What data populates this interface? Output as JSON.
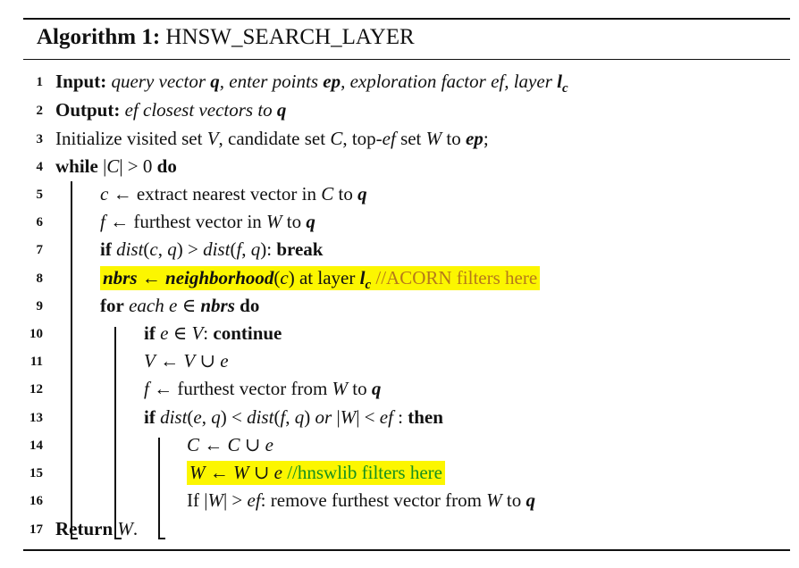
{
  "algorithm": {
    "label": "Algorithm 1:",
    "name": "HNSW_SEARCH_LAYER"
  },
  "lines": [
    {
      "n": "1",
      "parts": [
        [
          "kw",
          "Input:"
        ],
        [
          "t",
          " "
        ],
        [
          "it",
          "query vector "
        ],
        [
          "bi",
          "q"
        ],
        [
          "it",
          ", enter points "
        ],
        [
          "bi",
          "ep"
        ],
        [
          "it",
          ", exploration factor "
        ],
        [
          "it",
          "ef"
        ],
        [
          "it",
          ", layer "
        ],
        [
          "bi",
          "l"
        ],
        [
          "sub",
          "c"
        ]
      ]
    },
    {
      "n": "2",
      "parts": [
        [
          "kw",
          "Output:"
        ],
        [
          "t",
          " "
        ],
        [
          "it",
          "ef"
        ],
        [
          "it",
          "  closest vectors to "
        ],
        [
          "bi",
          "q"
        ]
      ]
    },
    {
      "n": "3",
      "parts": [
        [
          "t",
          "Initialize visited set "
        ],
        [
          "it",
          "V"
        ],
        [
          "t",
          ", candidate set "
        ],
        [
          "it",
          "C"
        ],
        [
          "t",
          ", top-"
        ],
        [
          "it",
          "ef"
        ],
        [
          "t",
          " set "
        ],
        [
          "it",
          "W"
        ],
        [
          "t",
          " to "
        ],
        [
          "bi",
          "ep"
        ],
        [
          "t",
          ";"
        ]
      ]
    },
    {
      "n": "4",
      "parts": [
        [
          "kw",
          "while"
        ],
        [
          "t",
          " |"
        ],
        [
          "it",
          "C"
        ],
        [
          "t",
          "| > 0 "
        ],
        [
          "kw",
          "do"
        ]
      ]
    },
    {
      "n": "5",
      "parts": [
        [
          "it",
          "c"
        ],
        [
          "t",
          " ← extract nearest vector in "
        ],
        [
          "it",
          "C"
        ],
        [
          "t",
          " to "
        ],
        [
          "bi",
          "q"
        ]
      ]
    },
    {
      "n": "6",
      "parts": [
        [
          "it",
          "f"
        ],
        [
          "t",
          " ← furthest vector in "
        ],
        [
          "it",
          "W"
        ],
        [
          "t",
          " to "
        ],
        [
          "bi",
          "q"
        ]
      ]
    },
    {
      "n": "7",
      "parts": [
        [
          "kw",
          "if"
        ],
        [
          "t",
          " "
        ],
        [
          "it",
          "dist"
        ],
        [
          "t",
          "("
        ],
        [
          "it",
          "c"
        ],
        [
          "t",
          ", "
        ],
        [
          "it",
          "q"
        ],
        [
          "t",
          ") > "
        ],
        [
          "it",
          "dist"
        ],
        [
          "t",
          "("
        ],
        [
          "it",
          "f"
        ],
        [
          "t",
          ", "
        ],
        [
          "it",
          "q"
        ],
        [
          "t",
          "): "
        ],
        [
          "kw",
          "break"
        ]
      ]
    },
    {
      "n": "8",
      "hl": "orange",
      "parts": [
        [
          "bi",
          "nbrs"
        ],
        [
          "t",
          " ← "
        ],
        [
          "bi",
          "neighborhood"
        ],
        [
          "t",
          "("
        ],
        [
          "it",
          "c"
        ],
        [
          "t",
          ") at layer "
        ],
        [
          "bi",
          "l"
        ],
        [
          "sub",
          "c"
        ],
        [
          "t",
          " "
        ],
        [
          "cmo",
          "//ACORN filters here"
        ]
      ]
    },
    {
      "n": "9",
      "parts": [
        [
          "kw",
          "for"
        ],
        [
          "t",
          " "
        ],
        [
          "it",
          "each "
        ],
        [
          "it",
          "e"
        ],
        [
          "t",
          " ∈ "
        ],
        [
          "bi",
          "nbrs"
        ],
        [
          "t",
          " "
        ],
        [
          "kw",
          "do"
        ]
      ]
    },
    {
      "n": "10",
      "parts": [
        [
          "kw",
          "if"
        ],
        [
          "t",
          " "
        ],
        [
          "it",
          "e"
        ],
        [
          "t",
          " ∈ "
        ],
        [
          "it",
          "V"
        ],
        [
          "t",
          ": "
        ],
        [
          "kw",
          "continue"
        ]
      ]
    },
    {
      "n": "11",
      "parts": [
        [
          "it",
          "V"
        ],
        [
          "t",
          " ← "
        ],
        [
          "it",
          "V"
        ],
        [
          "t",
          " ∪ "
        ],
        [
          "it",
          "e"
        ]
      ]
    },
    {
      "n": "12",
      "parts": [
        [
          "it",
          "f"
        ],
        [
          "t",
          " ← furthest vector from "
        ],
        [
          "it",
          "W"
        ],
        [
          "t",
          " to "
        ],
        [
          "bi",
          "q"
        ]
      ]
    },
    {
      "n": "13",
      "parts": [
        [
          "kw",
          "if"
        ],
        [
          "t",
          " "
        ],
        [
          "it",
          "dist"
        ],
        [
          "t",
          "("
        ],
        [
          "it",
          "e"
        ],
        [
          "t",
          ", "
        ],
        [
          "it",
          "q"
        ],
        [
          "t",
          ") < "
        ],
        [
          "it",
          "dist"
        ],
        [
          "t",
          "("
        ],
        [
          "it",
          "f"
        ],
        [
          "t",
          ", "
        ],
        [
          "it",
          "q"
        ],
        [
          "t",
          ") "
        ],
        [
          "it",
          "or"
        ],
        [
          "t",
          " |"
        ],
        [
          "it",
          "W"
        ],
        [
          "t",
          "| < "
        ],
        [
          "it",
          "ef"
        ],
        [
          "t",
          " : "
        ],
        [
          "kw",
          "then"
        ]
      ]
    },
    {
      "n": "14",
      "parts": [
        [
          "it",
          "C"
        ],
        [
          "t",
          " ← "
        ],
        [
          "it",
          "C"
        ],
        [
          "t",
          " ∪ "
        ],
        [
          "it",
          "e"
        ]
      ]
    },
    {
      "n": "15",
      "hl": "green",
      "parts": [
        [
          "it",
          "W"
        ],
        [
          "t",
          " ← "
        ],
        [
          "it",
          "W"
        ],
        [
          "t",
          " ∪ "
        ],
        [
          "it",
          "e"
        ],
        [
          "t",
          " "
        ],
        [
          "cmg",
          "//hnswlib filters here"
        ]
      ]
    },
    {
      "n": "16",
      "parts": [
        [
          "t",
          "If |"
        ],
        [
          "it",
          "W"
        ],
        [
          "t",
          "| > "
        ],
        [
          "it",
          "ef"
        ],
        [
          "t",
          ": remove furthest vector from "
        ],
        [
          "it",
          "W"
        ],
        [
          "t",
          " to "
        ],
        [
          "bi",
          "q"
        ]
      ]
    },
    {
      "n": "17",
      "parts": [
        [
          "kw",
          "Return"
        ],
        [
          "t",
          " "
        ],
        [
          "it",
          "W"
        ],
        [
          "t",
          "."
        ]
      ]
    }
  ],
  "highlight_color": "#fcf600",
  "comment_colors": {
    "orange": "#b5791a",
    "green": "#17901f"
  }
}
